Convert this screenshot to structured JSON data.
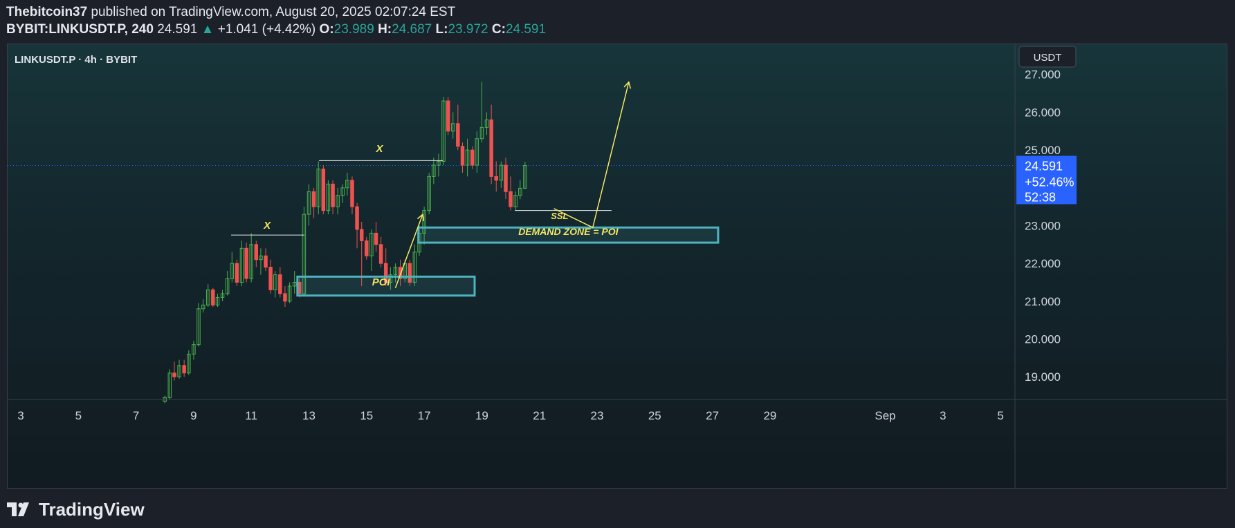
{
  "header": {
    "author": "Thebitcoin37",
    "published": "published on TradingView.com, August 20, 2025 02:07:24 EST",
    "symbol_tf": "BYBIT:LINKUSDT.P, 240",
    "last": "24.591",
    "change": "+1.041 (+4.42%)",
    "o_label": "O:",
    "o": "23.989",
    "h_label": "H:",
    "h": "24.687",
    "l_label": "L:",
    "l": "23.972",
    "c_label": "C:",
    "c": "24.591"
  },
  "chart": {
    "symbol_line": "LINKUSDT.P · 4h · BYBIT",
    "currency": "USDT",
    "price_box": {
      "price": "24.591",
      "change": "+52.46%",
      "countdown": "52:38"
    }
  },
  "footer": {
    "brand": "TradingView"
  },
  "colors": {
    "up": "#26a69a",
    "down": "#ef5350",
    "candle_up": "#4caf50",
    "annotation": "#f5e663",
    "zone_border": "#4fb3bf",
    "price_box": "#2962ff"
  },
  "chart_data": {
    "type": "candlestick",
    "ylim": [
      18.4,
      27.8
    ],
    "y_ticks": [
      19,
      20,
      21,
      22,
      23,
      24,
      25,
      26,
      27
    ],
    "y_tick_labels": [
      "19.000",
      "20.000",
      "21.000",
      "22.000",
      "23.000",
      "25.000",
      "26.000",
      "27.000"
    ],
    "x_range": [
      2.6,
      6.8
    ],
    "x_ticks": [
      {
        "x": 3,
        "label": "3"
      },
      {
        "x": 5,
        "label": "5"
      },
      {
        "x": 7,
        "label": "7"
      },
      {
        "x": 9,
        "label": "9"
      },
      {
        "x": 11,
        "label": "11"
      },
      {
        "x": 13,
        "label": "13"
      },
      {
        "x": 15,
        "label": "15"
      },
      {
        "x": 17,
        "label": "17"
      },
      {
        "x": 19,
        "label": "19"
      },
      {
        "x": 21,
        "label": "21"
      },
      {
        "x": 23,
        "label": "23"
      },
      {
        "x": 25,
        "label": "25"
      },
      {
        "x": 27,
        "label": "27"
      },
      {
        "x": 29,
        "label": "29"
      },
      {
        "x": 33,
        "label": "Sep"
      },
      {
        "x": 35,
        "label": "3"
      },
      {
        "x": 37,
        "label": "5"
      }
    ],
    "last_price": 24.591,
    "candles": [
      {
        "x": 8.0,
        "o": 18.35,
        "h": 18.5,
        "l": 18.3,
        "c": 18.45
      },
      {
        "x": 8.17,
        "o": 18.45,
        "h": 19.2,
        "l": 18.4,
        "c": 19.1
      },
      {
        "x": 8.33,
        "o": 19.1,
        "h": 19.4,
        "l": 18.9,
        "c": 19.0
      },
      {
        "x": 8.5,
        "o": 19.0,
        "h": 19.45,
        "l": 18.95,
        "c": 19.3
      },
      {
        "x": 8.67,
        "o": 19.3,
        "h": 19.45,
        "l": 19.0,
        "c": 19.1
      },
      {
        "x": 8.83,
        "o": 19.1,
        "h": 19.7,
        "l": 19.05,
        "c": 19.6
      },
      {
        "x": 9.0,
        "o": 19.6,
        "h": 19.95,
        "l": 19.45,
        "c": 19.85
      },
      {
        "x": 9.17,
        "o": 19.85,
        "h": 20.95,
        "l": 19.8,
        "c": 20.8
      },
      {
        "x": 9.33,
        "o": 20.8,
        "h": 21.05,
        "l": 20.7,
        "c": 20.9
      },
      {
        "x": 9.5,
        "o": 20.9,
        "h": 21.45,
        "l": 20.85,
        "c": 21.3
      },
      {
        "x": 9.67,
        "o": 21.3,
        "h": 21.35,
        "l": 20.85,
        "c": 20.9
      },
      {
        "x": 9.83,
        "o": 20.9,
        "h": 21.2,
        "l": 20.85,
        "c": 21.1
      },
      {
        "x": 10.0,
        "o": 21.1,
        "h": 21.3,
        "l": 21.0,
        "c": 21.2
      },
      {
        "x": 10.17,
        "o": 21.2,
        "h": 21.8,
        "l": 21.15,
        "c": 21.6
      },
      {
        "x": 10.33,
        "o": 21.6,
        "h": 22.3,
        "l": 21.5,
        "c": 22.0
      },
      {
        "x": 10.5,
        "o": 22.0,
        "h": 22.1,
        "l": 21.4,
        "c": 21.5
      },
      {
        "x": 10.67,
        "o": 21.5,
        "h": 22.6,
        "l": 21.4,
        "c": 22.4
      },
      {
        "x": 10.83,
        "o": 22.4,
        "h": 22.55,
        "l": 21.5,
        "c": 21.6
      },
      {
        "x": 11.0,
        "o": 21.6,
        "h": 22.8,
        "l": 21.5,
        "c": 22.5
      },
      {
        "x": 11.17,
        "o": 22.5,
        "h": 22.6,
        "l": 21.9,
        "c": 22.1
      },
      {
        "x": 11.33,
        "o": 22.1,
        "h": 22.4,
        "l": 21.7,
        "c": 22.2
      },
      {
        "x": 11.5,
        "o": 22.2,
        "h": 22.4,
        "l": 21.8,
        "c": 21.9
      },
      {
        "x": 11.67,
        "o": 21.9,
        "h": 22.1,
        "l": 21.2,
        "c": 21.3
      },
      {
        "x": 11.83,
        "o": 21.3,
        "h": 21.8,
        "l": 21.1,
        "c": 21.7
      },
      {
        "x": 12.0,
        "o": 21.7,
        "h": 21.9,
        "l": 21.1,
        "c": 21.2
      },
      {
        "x": 12.17,
        "o": 21.2,
        "h": 21.4,
        "l": 20.85,
        "c": 21.0
      },
      {
        "x": 12.33,
        "o": 21.0,
        "h": 21.5,
        "l": 20.95,
        "c": 21.4
      },
      {
        "x": 12.5,
        "o": 21.4,
        "h": 21.8,
        "l": 21.2,
        "c": 21.5
      },
      {
        "x": 12.67,
        "o": 21.5,
        "h": 21.6,
        "l": 21.1,
        "c": 21.2
      },
      {
        "x": 12.83,
        "o": 21.2,
        "h": 23.5,
        "l": 21.15,
        "c": 23.3
      },
      {
        "x": 13.0,
        "o": 23.3,
        "h": 24.1,
        "l": 23.0,
        "c": 23.9
      },
      {
        "x": 13.17,
        "o": 23.9,
        "h": 24.0,
        "l": 23.2,
        "c": 23.5
      },
      {
        "x": 13.33,
        "o": 23.5,
        "h": 24.7,
        "l": 23.3,
        "c": 24.5
      },
      {
        "x": 13.5,
        "o": 24.5,
        "h": 24.6,
        "l": 23.3,
        "c": 23.4
      },
      {
        "x": 13.67,
        "o": 23.4,
        "h": 24.2,
        "l": 23.3,
        "c": 24.1
      },
      {
        "x": 13.83,
        "o": 24.1,
        "h": 24.2,
        "l": 23.3,
        "c": 23.5
      },
      {
        "x": 14.0,
        "o": 23.5,
        "h": 24.0,
        "l": 23.3,
        "c": 23.8
      },
      {
        "x": 14.17,
        "o": 23.8,
        "h": 24.1,
        "l": 23.6,
        "c": 24.0
      },
      {
        "x": 14.33,
        "o": 24.0,
        "h": 24.4,
        "l": 23.8,
        "c": 24.2
      },
      {
        "x": 14.5,
        "o": 24.2,
        "h": 24.3,
        "l": 23.3,
        "c": 23.5
      },
      {
        "x": 14.67,
        "o": 23.5,
        "h": 23.6,
        "l": 22.4,
        "c": 22.9
      },
      {
        "x": 14.83,
        "o": 22.9,
        "h": 23.1,
        "l": 21.4,
        "c": 22.6
      },
      {
        "x": 15.0,
        "o": 22.6,
        "h": 22.7,
        "l": 22.1,
        "c": 22.2
      },
      {
        "x": 15.17,
        "o": 22.2,
        "h": 22.9,
        "l": 21.8,
        "c": 22.8
      },
      {
        "x": 15.33,
        "o": 22.8,
        "h": 23.1,
        "l": 22.3,
        "c": 22.5
      },
      {
        "x": 15.5,
        "o": 22.5,
        "h": 22.7,
        "l": 21.9,
        "c": 22.0
      },
      {
        "x": 15.67,
        "o": 22.0,
        "h": 22.4,
        "l": 21.4,
        "c": 21.5
      },
      {
        "x": 15.83,
        "o": 21.5,
        "h": 21.9,
        "l": 21.3,
        "c": 21.7
      },
      {
        "x": 16.0,
        "o": 21.7,
        "h": 22.0,
        "l": 21.5,
        "c": 21.9
      },
      {
        "x": 16.17,
        "o": 21.9,
        "h": 22.1,
        "l": 21.4,
        "c": 21.6
      },
      {
        "x": 16.33,
        "o": 21.6,
        "h": 22.1,
        "l": 21.5,
        "c": 22.0
      },
      {
        "x": 16.5,
        "o": 22.0,
        "h": 22.1,
        "l": 21.4,
        "c": 21.5
      },
      {
        "x": 16.67,
        "o": 21.5,
        "h": 22.5,
        "l": 21.4,
        "c": 22.3
      },
      {
        "x": 16.83,
        "o": 22.3,
        "h": 23.0,
        "l": 22.2,
        "c": 22.8
      },
      {
        "x": 17.0,
        "o": 22.8,
        "h": 23.5,
        "l": 22.5,
        "c": 23.4
      },
      {
        "x": 17.17,
        "o": 23.4,
        "h": 24.4,
        "l": 23.3,
        "c": 24.3
      },
      {
        "x": 17.33,
        "o": 24.3,
        "h": 24.8,
        "l": 24.1,
        "c": 24.6
      },
      {
        "x": 17.5,
        "o": 24.6,
        "h": 24.9,
        "l": 24.3,
        "c": 24.7
      },
      {
        "x": 17.67,
        "o": 24.7,
        "h": 26.4,
        "l": 24.6,
        "c": 26.3
      },
      {
        "x": 17.83,
        "o": 26.3,
        "h": 26.4,
        "l": 25.4,
        "c": 25.5
      },
      {
        "x": 18.0,
        "o": 25.5,
        "h": 26.0,
        "l": 25.3,
        "c": 25.7
      },
      {
        "x": 18.17,
        "o": 25.7,
        "h": 26.2,
        "l": 25.0,
        "c": 25.1
      },
      {
        "x": 18.33,
        "o": 25.1,
        "h": 25.2,
        "l": 24.4,
        "c": 24.6
      },
      {
        "x": 18.5,
        "o": 24.6,
        "h": 25.3,
        "l": 24.3,
        "c": 25.0
      },
      {
        "x": 18.67,
        "o": 25.0,
        "h": 25.1,
        "l": 24.5,
        "c": 24.6
      },
      {
        "x": 18.83,
        "o": 24.6,
        "h": 25.5,
        "l": 24.4,
        "c": 25.3
      },
      {
        "x": 19.0,
        "o": 25.3,
        "h": 26.8,
        "l": 25.2,
        "c": 25.6
      },
      {
        "x": 19.17,
        "o": 25.6,
        "h": 26.0,
        "l": 25.4,
        "c": 25.8
      },
      {
        "x": 19.33,
        "o": 25.8,
        "h": 26.2,
        "l": 24.1,
        "c": 24.3
      },
      {
        "x": 19.5,
        "o": 24.3,
        "h": 24.7,
        "l": 23.9,
        "c": 24.2
      },
      {
        "x": 19.67,
        "o": 24.2,
        "h": 24.7,
        "l": 24.0,
        "c": 24.6
      },
      {
        "x": 19.83,
        "o": 24.6,
        "h": 24.8,
        "l": 23.7,
        "c": 23.9
      },
      {
        "x": 20.0,
        "o": 23.9,
        "h": 24.3,
        "l": 23.4,
        "c": 23.5
      },
      {
        "x": 20.17,
        "o": 23.5,
        "h": 23.9,
        "l": 23.4,
        "c": 23.8
      },
      {
        "x": 20.33,
        "o": 23.8,
        "h": 24.2,
        "l": 23.7,
        "c": 23.989
      },
      {
        "x": 20.5,
        "o": 23.989,
        "h": 24.687,
        "l": 23.972,
        "c": 24.591
      }
    ],
    "annotations": {
      "x_label": "X",
      "poi_label": "POI",
      "demand_zone_label": "DEMAND ZONE = POI",
      "ssl_label": "SSL",
      "zones": [
        {
          "x1": 12.6,
          "x2": 18.75,
          "y1": 21.15,
          "y2": 21.65
        },
        {
          "x1": 16.8,
          "x2": 27.2,
          "y1": 22.55,
          "y2": 22.95
        }
      ],
      "lines": [
        {
          "x1": 10.3,
          "y1": 22.75,
          "x2": 12.85,
          "y2": 22.75
        },
        {
          "x1": 13.35,
          "y1": 24.72,
          "x2": 17.65,
          "y2": 24.72
        },
        {
          "x1": 20.15,
          "y1": 23.4,
          "x2": 23.5,
          "y2": 23.4
        }
      ],
      "arrows": [
        {
          "x1": 16.0,
          "y1": 21.35,
          "x2": 16.95,
          "y2": 23.3
        },
        {
          "x1": 21.5,
          "y1": 23.45,
          "x2": 22.85,
          "y2": 22.95,
          "x3": 24.1,
          "y3": 26.8
        }
      ],
      "label_positions": [
        {
          "key": "x1",
          "x": 11.55,
          "y": 22.92
        },
        {
          "key": "x2",
          "x": 15.45,
          "y": 24.95
        },
        {
          "key": "poi",
          "x": 15.5,
          "y": 21.42
        },
        {
          "key": "demand",
          "x": 22.0,
          "y": 22.75
        },
        {
          "key": "ssl",
          "x": 21.7,
          "y": 23.17
        }
      ]
    }
  }
}
